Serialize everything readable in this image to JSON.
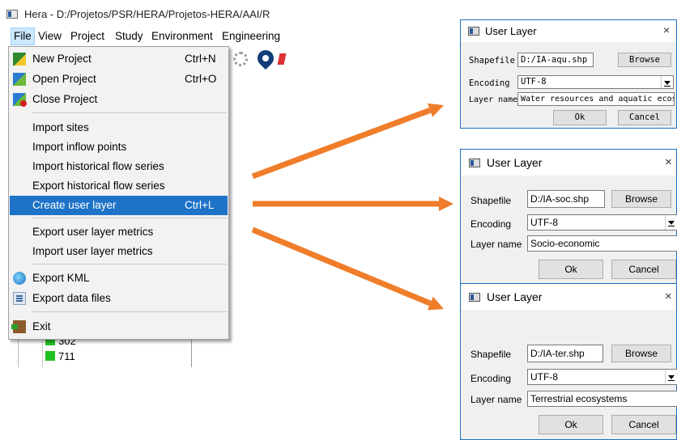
{
  "app": {
    "title": "Hera - D:/Projetos/PSR/HERA/Projetos-HERA/AAI/R",
    "menu": [
      "File",
      "View",
      "Project",
      "Study",
      "Environment",
      "Engineering"
    ]
  },
  "file_menu": {
    "items": [
      {
        "label": "New Project",
        "shortcut": "Ctrl+N",
        "icon": "new-project-icon"
      },
      {
        "label": "Open Project",
        "shortcut": "Ctrl+O",
        "icon": "open-project-icon"
      },
      {
        "label": "Close Project",
        "shortcut": "",
        "icon": "close-project-icon"
      },
      {
        "label": "Import sites",
        "shortcut": ""
      },
      {
        "label": "Import inflow points",
        "shortcut": ""
      },
      {
        "label": "Import historical flow series",
        "shortcut": ""
      },
      {
        "label": "Export historical flow series",
        "shortcut": ""
      },
      {
        "label": "Create user layer",
        "shortcut": "Ctrl+L",
        "highlighted": true
      },
      {
        "label": "Export user layer metrics",
        "shortcut": ""
      },
      {
        "label": "Import user layer metrics",
        "shortcut": ""
      },
      {
        "label": "Export KML",
        "shortcut": "",
        "icon": "globe-icon"
      },
      {
        "label": "Export data files",
        "shortcut": "",
        "icon": "export-file-icon"
      },
      {
        "label": "Exit",
        "shortcut": "",
        "icon": "exit-door-icon"
      }
    ]
  },
  "tree": {
    "items": [
      "302",
      "711"
    ],
    "item_color": "#22c122"
  },
  "arrow_color": "#ef7d2a",
  "dialogs": [
    {
      "title": "User Layer",
      "close_glyph": "×",
      "shapefile_label": "Shapefile",
      "shapefile_value": "D:/IA-aqu.shp",
      "browse_label": "Browse",
      "encoding_label": "Encoding",
      "encoding_value": "UTF-8",
      "layer_name_label": "Layer name",
      "layer_name_value": "Water resources and aquatic ecosystems",
      "ok_label": "Ok",
      "cancel_label": "Cancel"
    },
    {
      "title": "User Layer",
      "close_glyph": "×",
      "shapefile_label": "Shapefile",
      "shapefile_value": "D:/IA-soc.shp",
      "browse_label": "Browse",
      "encoding_label": "Encoding",
      "encoding_value": "UTF-8",
      "layer_name_label": "Layer name",
      "layer_name_value": "Socio-economic",
      "ok_label": "Ok",
      "cancel_label": "Cancel"
    },
    {
      "title": "User Layer",
      "close_glyph": "×",
      "shapefile_label": "Shapefile",
      "shapefile_value": "D:/IA-ter.shp",
      "browse_label": "Browse",
      "encoding_label": "Encoding",
      "encoding_value": "UTF-8",
      "layer_name_label": "Layer name",
      "layer_name_value": "Terrestrial ecosystems",
      "ok_label": "Ok",
      "cancel_label": "Cancel"
    }
  ]
}
